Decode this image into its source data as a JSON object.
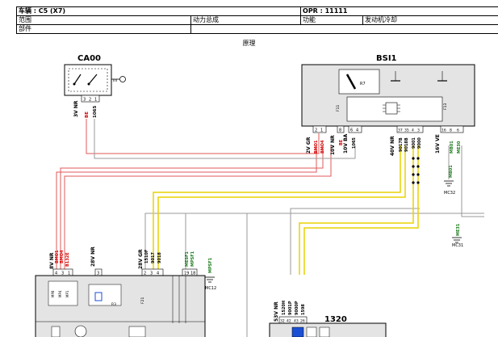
{
  "header": {
    "vehicle": "车辆 : C5 (X7)",
    "opr": "OPR : 11111",
    "scope_label": "范围",
    "scope_value": "动力总成",
    "function_label": "功能",
    "function_value": "发动机冷却",
    "part_label": "部件",
    "principle": "原理"
  },
  "components": {
    "ca00": "CA00",
    "bsi1": "BSI1",
    "c1320": "1320"
  },
  "connectors": {
    "ca00_conn": "3V NR",
    "ca00_pins": [
      "3",
      "2",
      "1"
    ],
    "ca00_wires": [
      "BE",
      "1065"
    ],
    "bsi_2v": "2V GR",
    "bsi_2v_pins": [
      "2",
      "1"
    ],
    "bsi_2v_wires": [
      "BMO1",
      "BMO4"
    ],
    "bsi_10v_nr": "10V NR",
    "bsi_10v_nr_pins": [
      "8"
    ],
    "bsi_10v_nr_wires": [
      "BE"
    ],
    "bsi_10v_ba": "10V BA",
    "bsi_10v_ba_pins": [
      "6",
      "4"
    ],
    "bsi_10v_ba_wires": [
      "1065"
    ],
    "bsi_40v": "40V NR",
    "bsi_40v_pins": [
      "37",
      "35",
      "4",
      "3"
    ],
    "bsi_40v_wires": [
      "9017B",
      "9018B",
      "9001",
      "9000"
    ],
    "bsi_16v": "16V VE",
    "bsi_16v_pins": [
      "16",
      "8",
      "6"
    ],
    "bsi_16v_wires": [
      "MB01",
      "ME30"
    ],
    "ecu_8v": "8V NR",
    "ecu_8v_pins": [
      "4",
      "3",
      "1"
    ],
    "ecu_8v_wires": [
      "BMO1",
      "BMO4",
      "B132E"
    ],
    "ecu_28v_nr": "28V NR",
    "ecu_28v_nr_pins": [
      "3"
    ],
    "ecu_28v_gr": "28V GR",
    "ecu_28v_gr_pins": [
      "2",
      "3",
      "4"
    ],
    "ecu_28v_gr_wires": [
      "1510F",
      "9017",
      "9018"
    ],
    "ecu_msf_pins": [
      "19",
      "18"
    ],
    "ecu_msf_wires": [
      "MESF1",
      "MPSF1"
    ],
    "c1320_conn": "53V NR",
    "c1320_pins": [
      "32",
      "42",
      "43",
      "26"
    ],
    "c1320_wires": [
      "1520H",
      "9001P",
      "9000P",
      "1598"
    ]
  },
  "grounds": {
    "mc32": "MC32",
    "mc31": "MC31",
    "mc12": "MC12",
    "mb01": "MB01",
    "me30": "ME30",
    "me31": "ME31",
    "mpsf1": "MPSF1"
  },
  "internal": {
    "r7": "R7",
    "f11": "F11",
    "f13": "F13",
    "f21": "F21",
    "r3": "R3",
    "ecu_pins": [
      "MP8",
      "MP4",
      "MP1"
    ]
  },
  "colors": {
    "wire_red": "#e05a5a",
    "wire_grey": "#9a9a9a",
    "wire_yellow": "#e8d200",
    "label_red": "#d40000",
    "label_green": "#1a7a1a"
  }
}
